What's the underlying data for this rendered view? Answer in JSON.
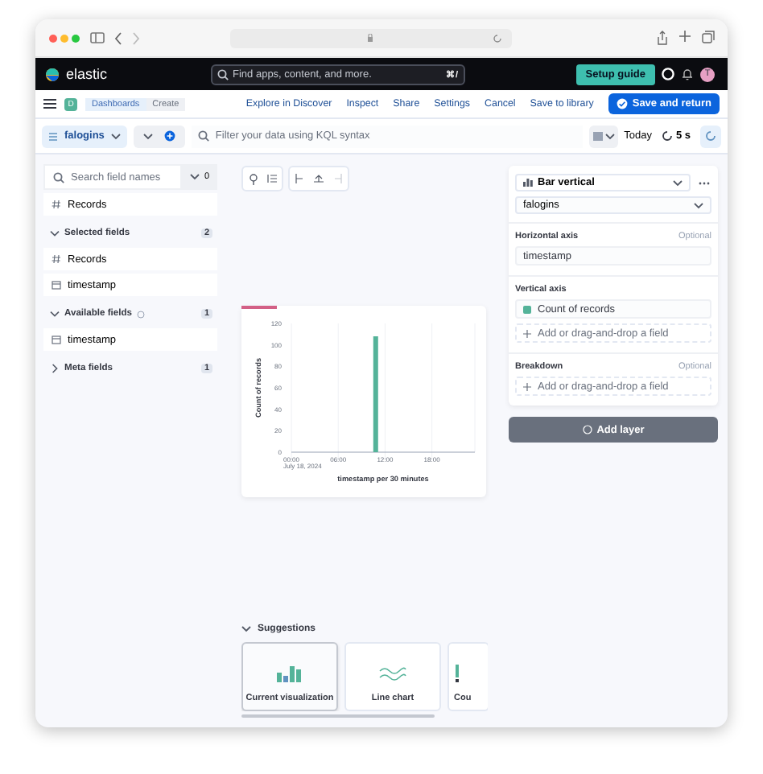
{
  "header": {
    "logo": "elastic",
    "search": {
      "placeholder": "Find apps, content, and more.",
      "shortcut": "⌘/"
    },
    "setup_guide": "Setup guide",
    "avatar": "T"
  },
  "breadcrumb_bar": {
    "app_badge": "D",
    "breadcrumbs": [
      "Dashboards",
      "Create"
    ],
    "actions": [
      "Explore in Discover",
      "Inspect",
      "Share",
      "Settings",
      "Cancel",
      "Save to library"
    ],
    "primary": "Save and return"
  },
  "query_bar": {
    "data_view": "falogins",
    "placeholder": "Filter your data using KQL syntax",
    "date": "Today",
    "refresh": "5 s"
  },
  "sidebar": {
    "search": {
      "placeholder": "Search field names"
    },
    "filter_count": "0",
    "top_fields": [
      {
        "name": "Records",
        "kind": "number"
      }
    ],
    "groups": [
      {
        "title": "Selected fields",
        "count": "2",
        "expanded": true,
        "info": false,
        "fields": [
          {
            "name": "Records",
            "kind": "number"
          },
          {
            "name": "timestamp",
            "kind": "date"
          }
        ]
      },
      {
        "title": "Available fields",
        "count": "1",
        "expanded": true,
        "info": true,
        "fields": [
          {
            "name": "timestamp",
            "kind": "date"
          }
        ]
      },
      {
        "title": "Meta fields",
        "count": "1",
        "expanded": false,
        "info": false
      }
    ]
  },
  "chart": {
    "date_label": "July 18, 2024",
    "chart_data": {
      "type": "bar",
      "xlabel": "timestamp per 30 minutes",
      "ylabel": "Count of records",
      "x": [
        10.8
      ],
      "series": [
        {
          "color": "#54b399",
          "values": [
            108
          ]
        }
      ],
      "grid": true,
      "xlim": [
        0,
        23.5
      ],
      "ylim": [
        0,
        120
      ],
      "yticks": [
        0,
        20,
        40,
        60,
        80,
        100,
        120
      ],
      "xticks": [
        {
          "value": 0,
          "label": "00:00"
        },
        {
          "value": 6,
          "label": "06:00"
        },
        {
          "value": 12,
          "label": "12:00"
        },
        {
          "value": 18,
          "label": "18:00"
        }
      ]
    }
  },
  "config_panel": {
    "chart_type": "Bar vertical",
    "data_view": "falogins",
    "sections": [
      {
        "title": "Horizontal axis",
        "optional": "Optional",
        "items": [
          {
            "label": "timestamp"
          }
        ]
      },
      {
        "title": "Vertical axis",
        "items": [
          {
            "label": "Count of records",
            "color": "#54b399"
          }
        ],
        "add": "Add or drag-and-drop a field"
      },
      {
        "title": "Breakdown",
        "optional": "Optional",
        "add": "Add or drag-and-drop a field"
      }
    ],
    "add_layer": "Add layer"
  },
  "suggestions": {
    "title": "Suggestions",
    "items": [
      {
        "label": "Current visualization",
        "kind": "bar",
        "selected": true
      },
      {
        "label": "Line chart",
        "kind": "line",
        "selected": false
      },
      {
        "label": "Cou",
        "kind": "metric",
        "selected": false
      }
    ]
  }
}
